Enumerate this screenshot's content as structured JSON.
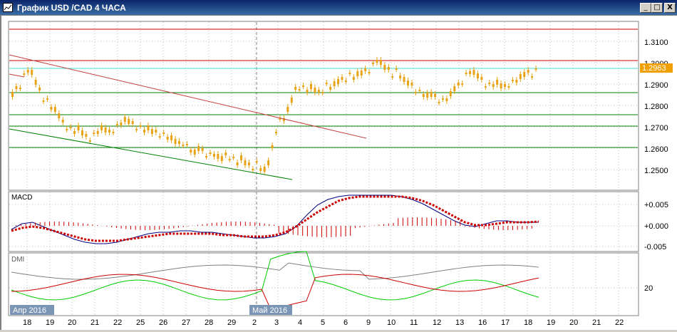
{
  "window": {
    "title": "График USD /CAD  4 ЧАСА",
    "icon": "chart-window-icon",
    "buttons": {
      "minimize": "_",
      "restore": "□",
      "close": "X"
    }
  },
  "price_panel": {
    "y_ticks": [
      "1.3100",
      "1.3000",
      "1.2900",
      "1.2800",
      "1.2700",
      "1.2600",
      "1.2500"
    ],
    "current_price": "1.2963",
    "current_price_color": "#f0a000"
  },
  "macd_panel": {
    "label": "MACD",
    "y_ticks": [
      "+0.005",
      "+0.000",
      "-0.005"
    ]
  },
  "dmi_panel": {
    "label": "DMI",
    "y_ticks": [
      "20"
    ]
  },
  "time_axis": {
    "month_labels": [
      "Апр 2016",
      "Май 2016"
    ],
    "day_labels": [
      "18",
      "19",
      "20",
      "21",
      "22",
      "25",
      "26",
      "27",
      "28",
      "29",
      "2",
      "3",
      "4",
      "5",
      "6",
      "9",
      "10",
      "11",
      "12",
      "13",
      "16",
      "17",
      "18",
      "19",
      "20",
      "21",
      "22"
    ]
  },
  "colors": {
    "candle": "#e8a317",
    "macd_line": "#000080",
    "signal_line": "#cc0000",
    "histogram": "#cc0000",
    "resistance": "#cc0000",
    "current_line": "#40e0d0",
    "support": "#008000",
    "dmi_plus": "#00cc00",
    "dmi_minus": "#cc0000",
    "adx": "#808080"
  }
}
